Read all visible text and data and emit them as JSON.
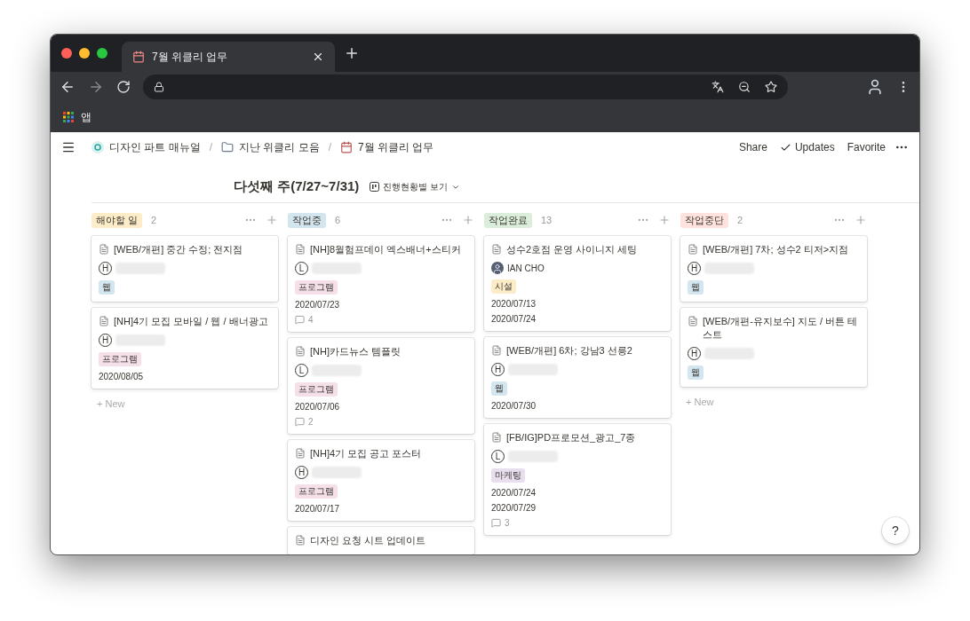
{
  "browser": {
    "tab_title": "7월 위클리 업무",
    "bookmarks": [
      {
        "label": "앱"
      }
    ]
  },
  "topbar": {
    "breadcrumbs": [
      {
        "label": "디자인 파트 매뉴얼"
      },
      {
        "separator": "/",
        "label": "지난 위클리 모음"
      },
      {
        "separator": "/",
        "label": "7월 위클리 업무"
      }
    ],
    "actions": [
      "Share",
      "Updates",
      "Favorite"
    ]
  },
  "view": {
    "title": "다섯째 주(7/27~7/31)",
    "view_name": "진행현황별 보기"
  },
  "columns": [
    {
      "label": "해야할 일",
      "color": "#fdecc8",
      "count": "2",
      "new_label": "+ New",
      "cards": [
        {
          "title": "[WEB/개편] 중간 수정; 전지점",
          "assignee": {
            "kind": "initial",
            "initial": "H"
          },
          "tags": [
            {
              "label": "웹",
              "color": "#d3e5ef"
            }
          ]
        },
        {
          "title": "[NH]4기 모집 모바일 / 웹 / 배너광고",
          "assignee": {
            "kind": "initial",
            "initial": "H"
          },
          "tags": [
            {
              "label": "프로그램",
              "color": "#f5e0e9"
            }
          ],
          "dates": [
            "2020/08/05"
          ]
        }
      ]
    },
    {
      "label": "작업중",
      "color": "#d3e5ef",
      "count": "6",
      "cards": [
        {
          "title": "[NH]8월험프데이 엑스배너+스티커",
          "assignee": {
            "kind": "initial",
            "initial": "L"
          },
          "tags": [
            {
              "label": "프로그램",
              "color": "#f5e0e9"
            }
          ],
          "dates": [
            "2020/07/23"
          ],
          "comments": "4"
        },
        {
          "title": "[NH]카드뉴스 템플릿",
          "assignee": {
            "kind": "initial",
            "initial": "L"
          },
          "tags": [
            {
              "label": "프로그램",
              "color": "#f5e0e9"
            }
          ],
          "dates": [
            "2020/07/06"
          ],
          "comments": "2"
        },
        {
          "title": "[NH]4기 모집 공고 포스터",
          "assignee": {
            "kind": "initial",
            "initial": "H"
          },
          "tags": [
            {
              "label": "프로그램",
              "color": "#f5e0e9"
            }
          ],
          "dates": [
            "2020/07/17"
          ]
        },
        {
          "title": "디자인 요청 시트 업데이트"
        }
      ]
    },
    {
      "label": "작업완료",
      "color": "#dbeddb",
      "count": "13",
      "cards": [
        {
          "title": "성수2호점 운영 사이니지 세팅",
          "assignee": {
            "kind": "photo",
            "name": "IAN CHO"
          },
          "tags": [
            {
              "label": "시설",
              "color": "#fdecc8"
            }
          ],
          "dates": [
            "2020/07/13",
            "2020/07/24"
          ]
        },
        {
          "title": "[WEB/개편] 6차; 강남3 선릉2",
          "assignee": {
            "kind": "initial",
            "initial": "H"
          },
          "tags": [
            {
              "label": "웹",
              "color": "#d3e5ef"
            }
          ],
          "dates": [
            "2020/07/30"
          ]
        },
        {
          "title": "[FB/IG]PD프로모션_광고_7종",
          "assignee": {
            "kind": "initial",
            "initial": "L"
          },
          "tags": [
            {
              "label": "마케팅",
              "color": "#e8deee"
            }
          ],
          "dates": [
            "2020/07/24",
            "2020/07/29"
          ],
          "comments": "3"
        }
      ]
    },
    {
      "label": "작업중단",
      "color": "#ffe2dd",
      "count": "2",
      "new_label": "+ New",
      "cards": [
        {
          "title": "[WEB/개편] 7차; 성수2 티저>지점",
          "assignee": {
            "kind": "initial",
            "initial": "H"
          },
          "tags": [
            {
              "label": "웹",
              "color": "#d3e5ef"
            }
          ]
        },
        {
          "title": "[WEB/개편-유지보수] 지도 / 버튼 테스트",
          "assignee": {
            "kind": "initial",
            "initial": "H"
          },
          "tags": [
            {
              "label": "웹",
              "color": "#d3e5ef"
            }
          ]
        }
      ]
    }
  ],
  "help": "?"
}
